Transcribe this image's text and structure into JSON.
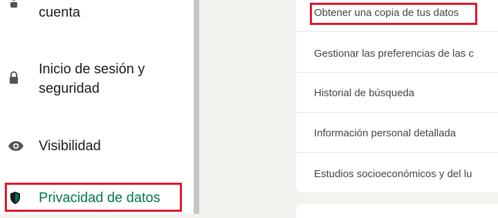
{
  "sidebar": {
    "items": [
      {
        "label": "cuenta",
        "icon": "person-icon"
      },
      {
        "label_line1": "Inicio de sesión y",
        "label_line2": "seguridad",
        "icon": "lock-icon"
      },
      {
        "label": "Visibilidad",
        "icon": "eye-icon"
      },
      {
        "label": "Privacidad de datos",
        "icon": "shield-icon",
        "active": true
      }
    ]
  },
  "main": {
    "rows": [
      {
        "label": "Obtener una copia de tus datos",
        "highlighted": true
      },
      {
        "label": "Gestionar las preferencias de las c"
      },
      {
        "label": "Historial de búsqueda"
      },
      {
        "label": "Información personal detallada"
      },
      {
        "label": "Estudios socioeconómicos y del lu"
      }
    ]
  },
  "colors": {
    "active_green": "#01754f",
    "highlight_red": "#e3132b",
    "page_bg": "#f4f2ee"
  }
}
